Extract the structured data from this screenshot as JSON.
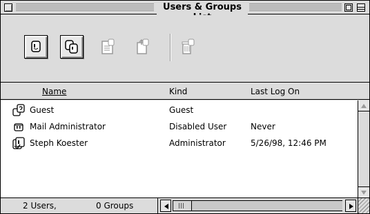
{
  "window": {
    "title": "Users & Groups List"
  },
  "toolbar": {
    "buttons": [
      {
        "name": "new-user-button",
        "icon": "new-user-icon",
        "enabled": true
      },
      {
        "name": "new-group-button",
        "icon": "new-group-icon",
        "enabled": true
      },
      {
        "name": "open-button",
        "icon": "open-document-icon",
        "enabled": false
      },
      {
        "name": "duplicate-button",
        "icon": "duplicate-icon",
        "enabled": false
      },
      {
        "name": "delete-button",
        "icon": "trash-icon",
        "enabled": false
      }
    ]
  },
  "columns": {
    "name": "Name",
    "kind": "Kind",
    "last_log_on": "Last Log On"
  },
  "rows": [
    {
      "name": "Guest",
      "kind": "Guest",
      "last_log_on": "",
      "icon": "guest-icon"
    },
    {
      "name": "Mail Administrator",
      "kind": "Disabled User",
      "last_log_on": "Never",
      "icon": "disabled-user-icon"
    },
    {
      "name": "Steph Koester",
      "kind": "Administrator",
      "last_log_on": "5/26/98, 12:46 PM",
      "icon": "administrator-icon"
    }
  ],
  "status": {
    "users": "2 Users,",
    "groups": "0 Groups"
  },
  "colors": {
    "chrome": "#dcdcdc",
    "list_background": "#ffffff",
    "border": "#000000"
  }
}
